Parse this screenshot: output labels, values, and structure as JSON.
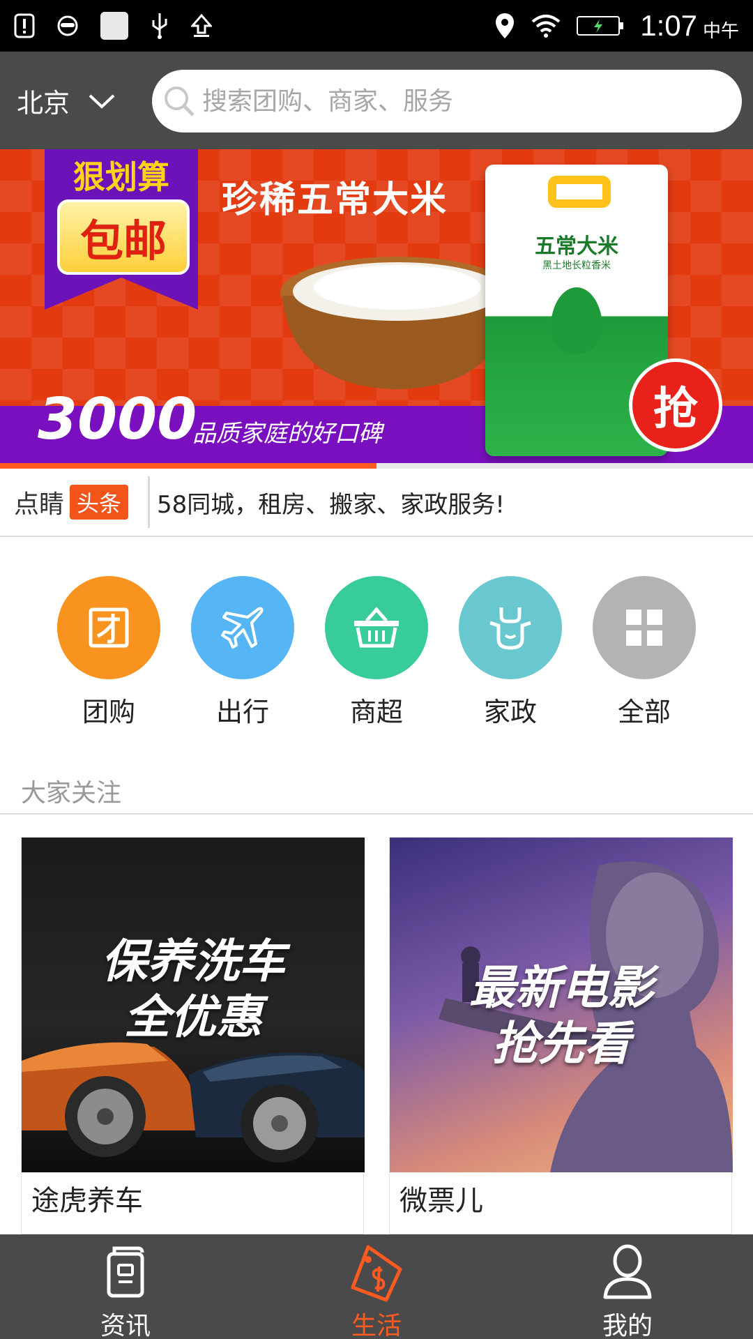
{
  "status_bar": {
    "time": "1:07",
    "ampm": "中午"
  },
  "header": {
    "city": "北京",
    "search_placeholder": "搜索团购、商家、服务"
  },
  "banner": {
    "ribbon_top": "狠划算",
    "ribbon_plate": "包邮",
    "title": "珍稀五常大米",
    "bag_title": "五常大米",
    "bag_sub": "黑土地长粒香米",
    "grab": "抢",
    "number": "3000",
    "number_sub": "品质家庭的好口碑",
    "progress": 0.5,
    "colors": {
      "background": "#e33a10",
      "band": "#7a0fbf"
    }
  },
  "ticker": {
    "brand": "点睛",
    "tag": "头条",
    "message": "58同城，租房、搬家、家政服务!"
  },
  "categories": [
    {
      "label": "团购",
      "icon": "group-buy-icon",
      "color": "#f7931e"
    },
    {
      "label": "出行",
      "icon": "airplane-icon",
      "color": "#56b6f5"
    },
    {
      "label": "商超",
      "icon": "basket-icon",
      "color": "#38cc98"
    },
    {
      "label": "家政",
      "icon": "apron-icon",
      "color": "#69c7cf"
    },
    {
      "label": "全部",
      "icon": "grid-icon",
      "color": "#b3b3b3"
    }
  ],
  "section": {
    "title": "大家关注"
  },
  "cards": [
    {
      "image_text_1": "保养洗车",
      "image_text_2": "全优惠",
      "name": "途虎养车"
    },
    {
      "image_text_1": "最新电影",
      "image_text_2": "抢先看",
      "name": "微票儿"
    }
  ],
  "bottom_nav": [
    {
      "label": "资讯",
      "icon": "news-icon",
      "active": false
    },
    {
      "label": "生活",
      "icon": "life-tag-icon",
      "active": true
    },
    {
      "label": "我的",
      "icon": "user-icon",
      "active": false
    }
  ],
  "colors": {
    "accent": "#ff5a1f",
    "header_bg": "#4a4a4a"
  }
}
